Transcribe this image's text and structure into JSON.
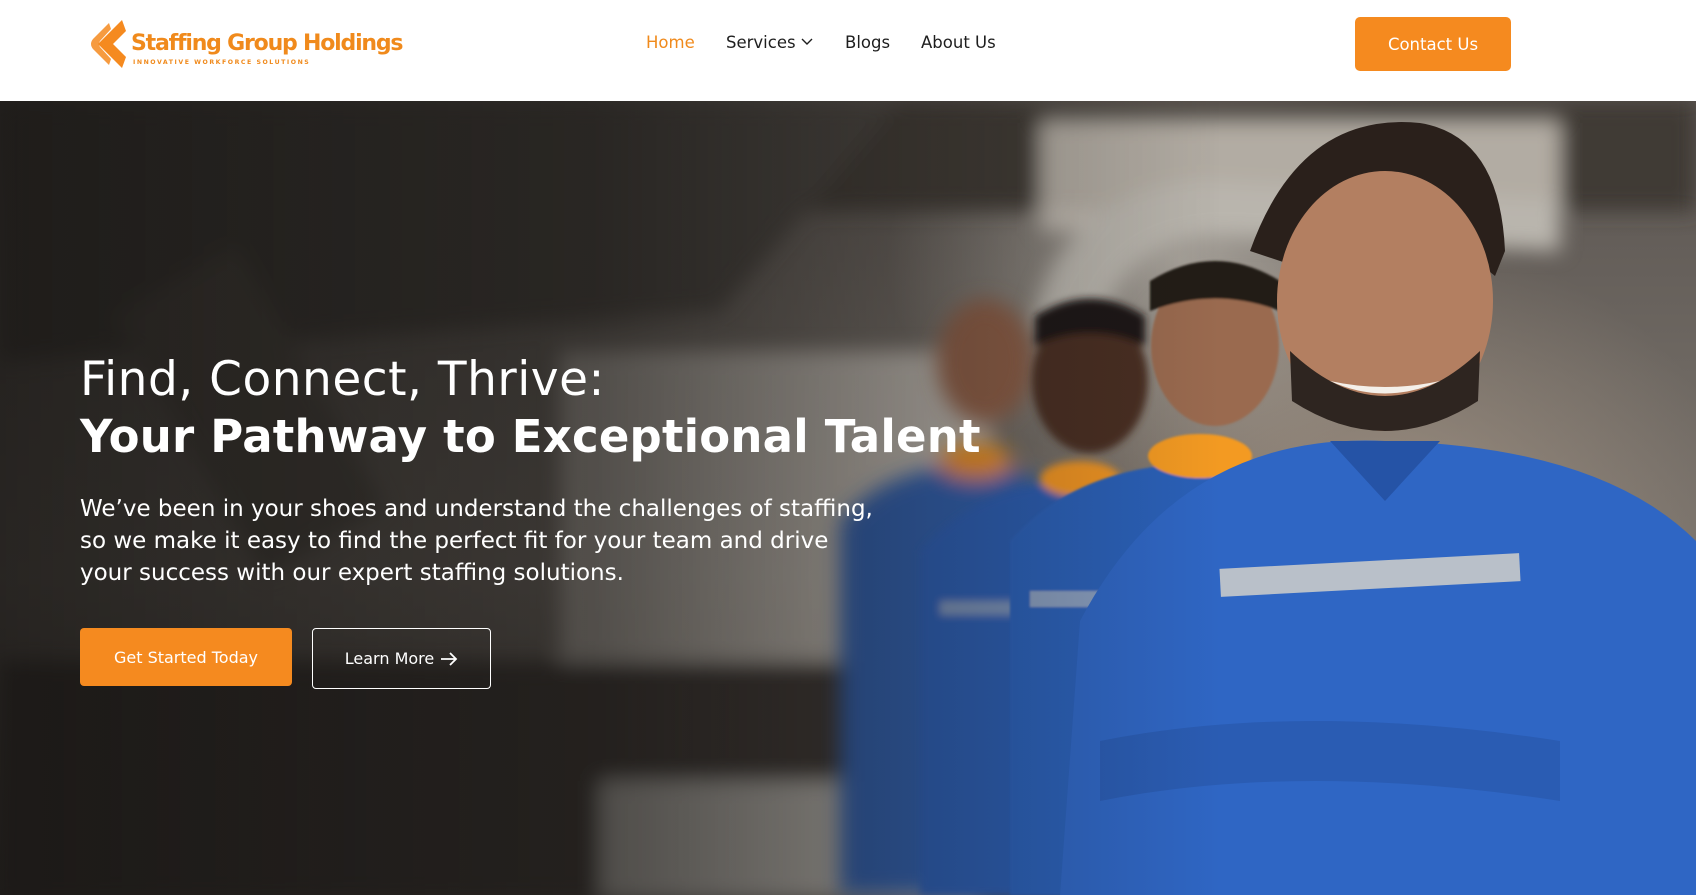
{
  "colors": {
    "brand_orange": "#f58a1f",
    "nav_active": "#f08a1c",
    "header_bg": "#ffffff",
    "hero_text": "#ffffff"
  },
  "logo": {
    "title": "Staffing Group Holdings",
    "tagline": "INNOVATIVE WORKFORCE SOLUTIONS",
    "icon": "chevron-left-logo-mark"
  },
  "nav": {
    "items": [
      {
        "label": "Home",
        "active": true
      },
      {
        "label": "Services",
        "has_dropdown": true,
        "icon": "chevron-down-icon"
      },
      {
        "label": "Blogs"
      },
      {
        "label": "About Us"
      }
    ]
  },
  "header": {
    "contact_label": "Contact Us"
  },
  "hero": {
    "title_line1": "Find, Connect, Thrive:",
    "title_line2": "Your Pathway to Exceptional Talent",
    "body": "We’ve been in your shoes and understand the challenges of staffing, so we make it easy to find the perfect fit for your team and drive your success with our expert staffing solutions.",
    "primary_cta": "Get Started Today",
    "secondary_cta": "Learn More",
    "secondary_cta_icon": "arrow-right-icon",
    "background_image": "team of workers in blue uniforms with ear protection in a factory"
  }
}
